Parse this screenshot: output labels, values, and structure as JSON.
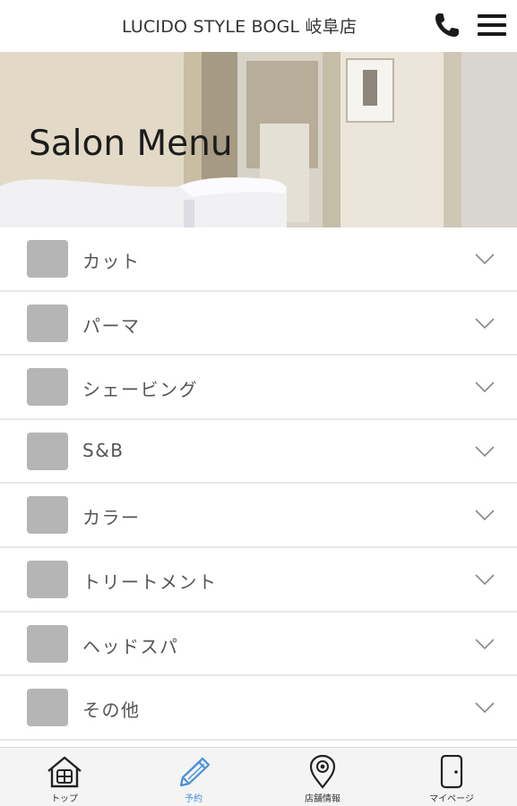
{
  "header": {
    "store_name": "LUCIDO STYLE BOGL 岐阜店",
    "phone_icon": "phone-icon",
    "menu_icon": "hamburger-menu-icon"
  },
  "hero": {
    "title": "Salon Menu"
  },
  "menu": {
    "items": [
      {
        "label": "カット"
      },
      {
        "label": "パーマ"
      },
      {
        "label": "シェービング"
      },
      {
        "label": "S&B"
      },
      {
        "label": "カラー"
      },
      {
        "label": "トリートメント"
      },
      {
        "label": "ヘッドスパ"
      },
      {
        "label": "その他"
      }
    ]
  },
  "tabbar": {
    "tabs": [
      {
        "label": "トップ",
        "icon": "home-icon"
      },
      {
        "label": "予約",
        "icon": "pencil-icon",
        "active": true
      },
      {
        "label": "店舗情報",
        "icon": "map-pin-icon"
      },
      {
        "label": "マイページ",
        "icon": "smartphone-icon"
      }
    ],
    "active_color": "#4a90d9"
  }
}
